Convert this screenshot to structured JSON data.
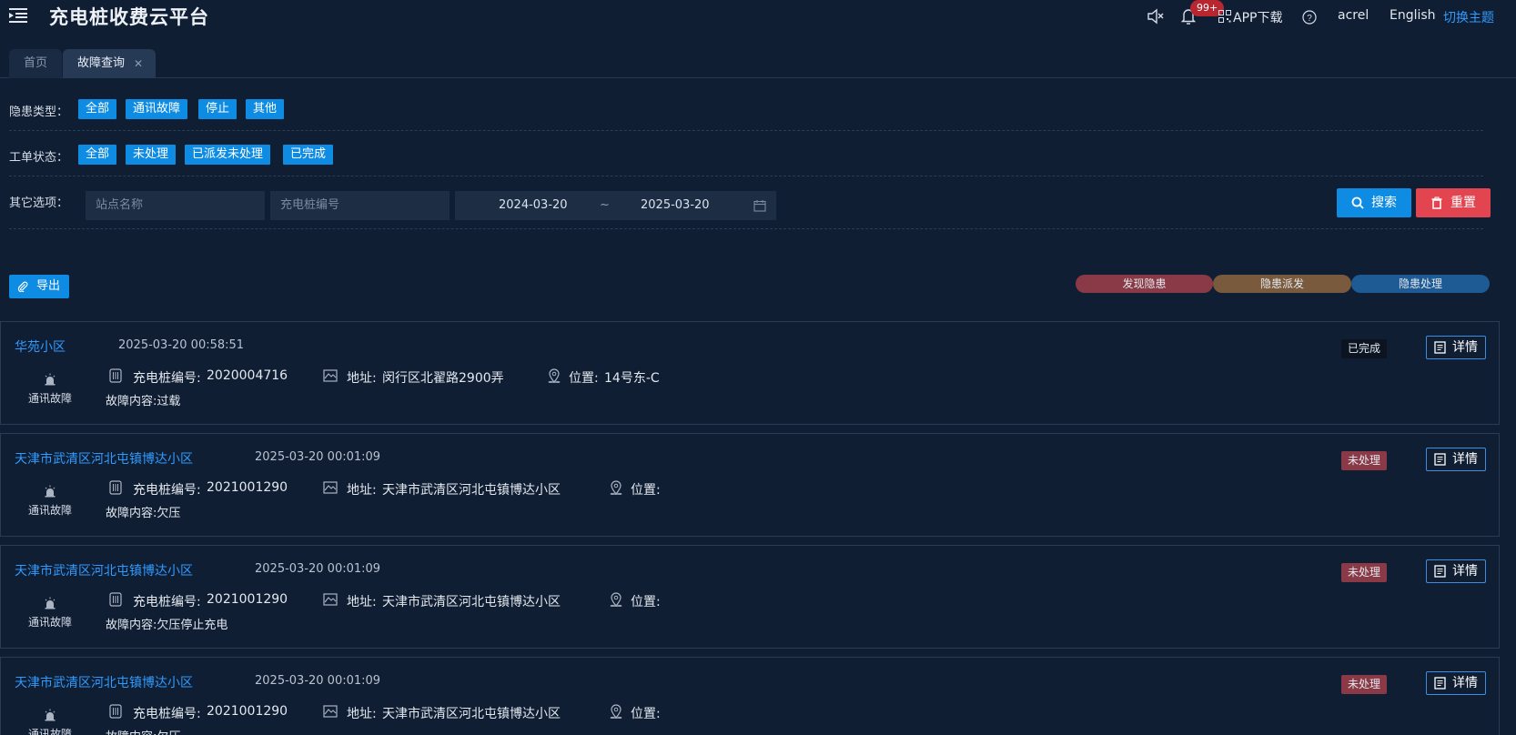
{
  "header": {
    "title": "充电桩收费云平台",
    "badge": "99+",
    "app_download": "APP下载",
    "user": "acrel",
    "language": "English",
    "theme": "切换主题"
  },
  "tabs": [
    {
      "label": "首页"
    },
    {
      "label": "故障查询"
    }
  ],
  "filters": {
    "hazard_type_label": "隐患类型：",
    "hazard_types": [
      "全部",
      "通讯故障",
      "停止",
      "其他"
    ],
    "order_status_label": "工单状态：",
    "order_statuses": [
      "全部",
      "未处理",
      "已派发未处理",
      "已完成"
    ],
    "other_label": "其它选项：",
    "station_placeholder": "站点名称",
    "pile_placeholder": "充电桩编号",
    "date_start": "2024-03-20",
    "date_sep": "~",
    "date_end": "2025-03-20",
    "search_label": "搜索",
    "reset_label": "重置"
  },
  "export_label": "导出",
  "legend": [
    "发现隐患",
    "隐患派发",
    "隐患处理"
  ],
  "labels": {
    "pile_no": "充电桩编号:",
    "address": "地址:",
    "position": "位置:",
    "detail": "详情"
  },
  "records": [
    {
      "station": "华苑小区",
      "time": "2025-03-20 00:58:51",
      "type": "通讯故障",
      "pile_no": "2020004716",
      "address": "闵行区北翟路2900弄",
      "position": "14号东-C",
      "content": "故障内容:过载",
      "status": "已完成"
    },
    {
      "station": "天津市武清区河北屯镇博达小区",
      "time": "2025-03-20 00:01:09",
      "type": "通讯故障",
      "pile_no": "2021001290",
      "address": "天津市武清区河北屯镇博达小区",
      "position": "",
      "content": "故障内容:欠压",
      "status": "未处理"
    },
    {
      "station": "天津市武清区河北屯镇博达小区",
      "time": "2025-03-20 00:01:09",
      "type": "通讯故障",
      "pile_no": "2021001290",
      "address": "天津市武清区河北屯镇博达小区",
      "position": "",
      "content": "故障内容:欠压停止充电",
      "status": "未处理"
    },
    {
      "station": "天津市武清区河北屯镇博达小区",
      "time": "2025-03-20 00:01:09",
      "type": "通讯故障",
      "pile_no": "2021001290",
      "address": "天津市武清区河北屯镇博达小区",
      "position": "",
      "content": "故障内容:欠压",
      "status": "未处理"
    }
  ]
}
